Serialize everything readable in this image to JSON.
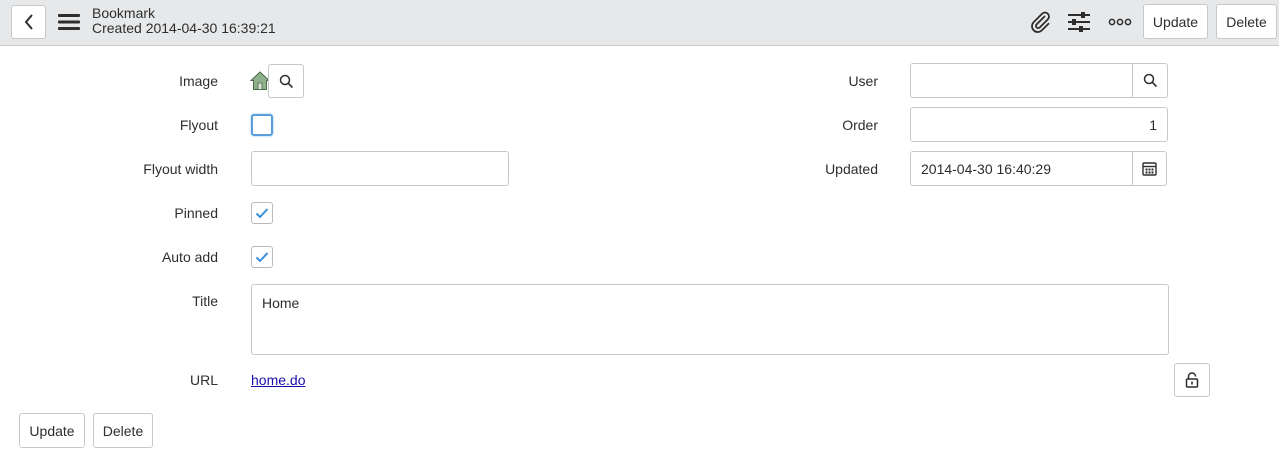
{
  "header": {
    "title": "Bookmark",
    "subtitle": "Created 2014-04-30 16:39:21",
    "update_label": "Update",
    "delete_label": "Delete"
  },
  "form": {
    "image": {
      "label": "Image"
    },
    "flyout": {
      "label": "Flyout",
      "checked": false
    },
    "flyout_width": {
      "label": "Flyout width",
      "value": ""
    },
    "pinned": {
      "label": "Pinned",
      "checked": true
    },
    "auto_add": {
      "label": "Auto add",
      "checked": true
    },
    "title": {
      "label": "Title",
      "value": "Home"
    },
    "url": {
      "label": "URL",
      "value": "home.do"
    },
    "user": {
      "label": "User",
      "value": ""
    },
    "order": {
      "label": "Order",
      "value": "1"
    },
    "updated": {
      "label": "Updated",
      "value": "2014-04-30 16:40:29"
    }
  },
  "footer": {
    "update_label": "Update",
    "delete_label": "Delete"
  },
  "colors": {
    "header_bg": "#e6e8ea",
    "check_accent": "#3b8ed8",
    "link": "#1a0dab"
  }
}
